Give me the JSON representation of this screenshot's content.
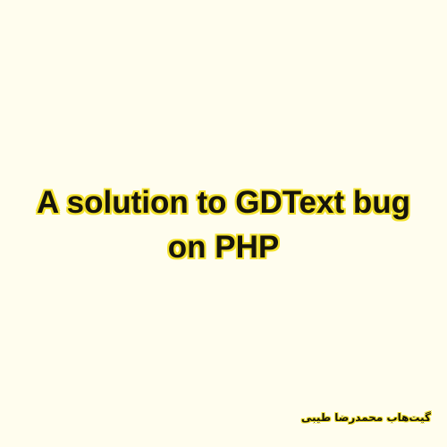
{
  "colors": {
    "background": "#fffdee",
    "text": "#16140c",
    "outline": "#f2e12c"
  },
  "headline": {
    "line1": "A solution to GDText bug",
    "line2": "on PHP"
  },
  "signature": "گیت‌هاب محمدرضا طیبی"
}
